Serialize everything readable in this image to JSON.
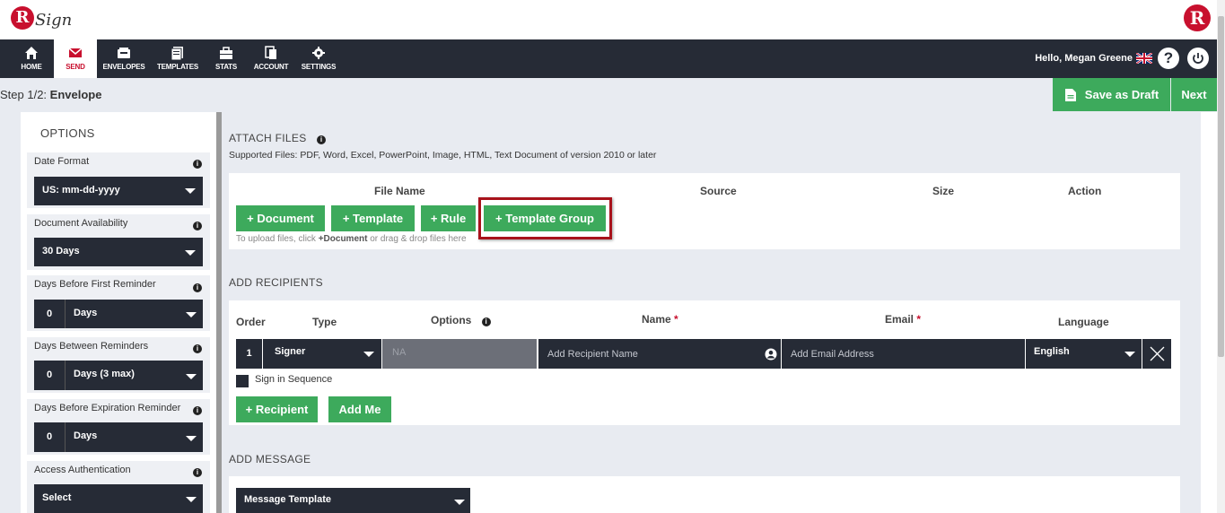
{
  "brand": {
    "logo_letter": "R",
    "logo_text": "Sign",
    "right_logo_letter": "R",
    "accent": "#c8102e",
    "green": "#3daa5c",
    "dark": "#262b36"
  },
  "nav": {
    "items": [
      {
        "label": "HOME",
        "icon": "home-icon"
      },
      {
        "label": "SEND",
        "icon": "envelope-icon",
        "active": true
      },
      {
        "label": "ENVELOPES",
        "icon": "inbox-icon"
      },
      {
        "label": "TEMPLATES",
        "icon": "templates-icon"
      },
      {
        "label": "STATS",
        "icon": "stats-icon"
      },
      {
        "label": "ACCOUNT",
        "icon": "account-icon"
      },
      {
        "label": "SETTINGS",
        "icon": "gear-icon"
      }
    ],
    "greeting": "Hello, Megan Greene",
    "help": "?"
  },
  "step": {
    "prefix": "Step 1/2:",
    "name": "Envelope"
  },
  "actions": {
    "save_draft": "Save as Draft",
    "next": "Next"
  },
  "options": {
    "title": "OPTIONS",
    "date_format": {
      "label": "Date Format",
      "value": "US: mm-dd-yyyy"
    },
    "availability": {
      "label": "Document Availability",
      "value": "30 Days"
    },
    "first_reminder": {
      "label": "Days Before First Reminder",
      "number": "0",
      "unit": "Days"
    },
    "between_reminders": {
      "label": "Days Between Reminders",
      "number": "0",
      "unit": "Days (3 max)"
    },
    "expiration": {
      "label": "Days Before Expiration Reminder",
      "number": "0",
      "unit": "Days"
    },
    "access_auth": {
      "label": "Access Authentication",
      "value": "Select"
    }
  },
  "attach": {
    "title": "ATTACH FILES",
    "supported": "Supported Files: PDF, Word, Excel, PowerPoint, Image, HTML, Text Document of version 2010 or later",
    "columns": {
      "file_name": "File Name",
      "source": "Source",
      "size": "Size",
      "action": "Action"
    },
    "buttons": {
      "document": "+ Document",
      "template": "+ Template",
      "rule": "+ Rule",
      "template_group": "+ Template Group"
    },
    "hint_pre": "To upload files, click ",
    "hint_bold": "+Document",
    "hint_post": " or drag & drop files here"
  },
  "recipients": {
    "title": "ADD RECIPIENTS",
    "columns": {
      "order": "Order",
      "type": "Type",
      "options": "Options",
      "name": "Name",
      "email": "Email",
      "language": "Language",
      "required_mark": "*"
    },
    "row": {
      "order": "1",
      "type": "Signer",
      "options": "NA",
      "name_placeholder": "Add Recipient Name",
      "email_placeholder": "Add Email Address",
      "language": "English"
    },
    "sequence_label": "Sign in Sequence",
    "buttons": {
      "recipient": "+ Recipient",
      "add_me": "Add Me"
    }
  },
  "message": {
    "title": "ADD MESSAGE",
    "template_select": "Message Template"
  }
}
